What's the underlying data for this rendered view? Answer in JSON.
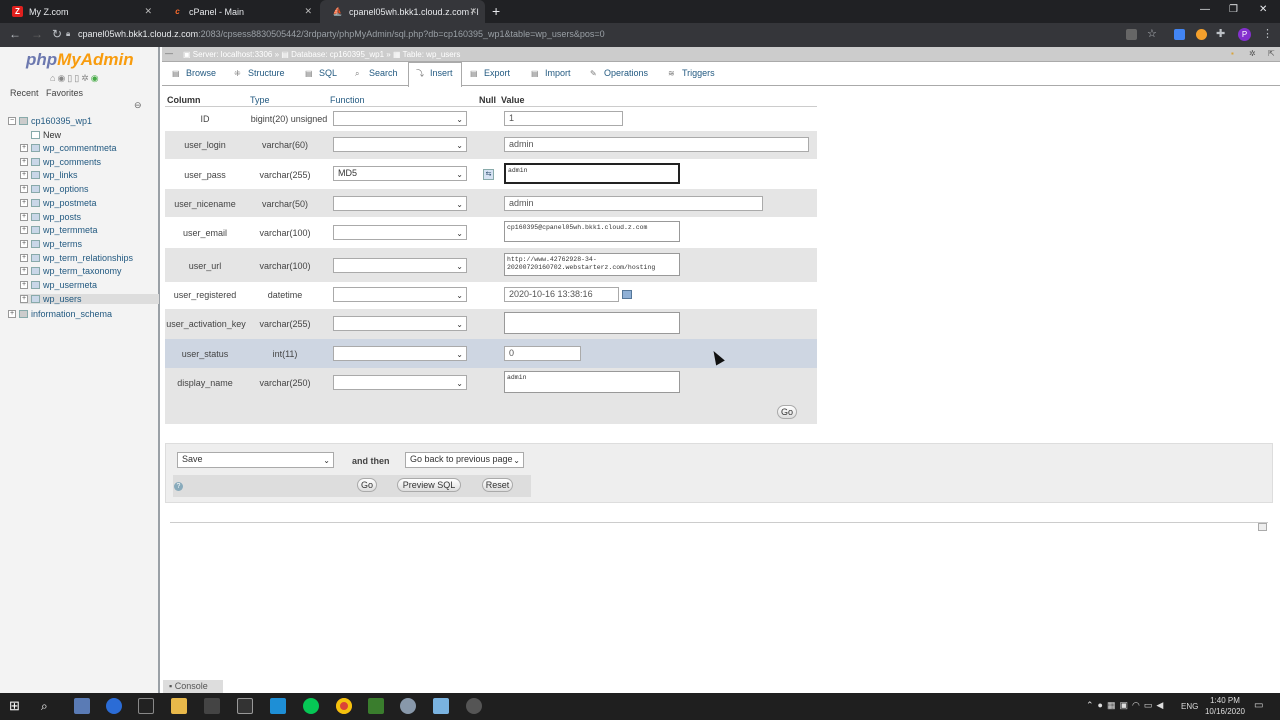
{
  "browser": {
    "tabs": [
      {
        "label": "My Z.com",
        "favicon": "Z"
      },
      {
        "label": "cPanel - Main",
        "favicon": "c"
      },
      {
        "label": "cpanel05wh.bkk1.cloud.z.com / l",
        "favicon": "pma"
      }
    ],
    "url_host": "cpanel05wh.bkk1.cloud.z.com",
    "url_rest": ":2083/cpsess8830505442/3rdparty/phpMyAdmin/sql.php?db=cp160395_wp1&table=wp_users&pos=0",
    "profile_initial": "P"
  },
  "nav": {
    "logo_php": "php",
    "logo_myadmin": "MyAdmin",
    "recent": "Recent",
    "favorites": "Favorites",
    "db": "cp160395_wp1",
    "new": "New",
    "tables": [
      "wp_commentmeta",
      "wp_comments",
      "wp_links",
      "wp_options",
      "wp_postmeta",
      "wp_posts",
      "wp_termmeta",
      "wp_terms",
      "wp_term_relationships",
      "wp_term_taxonomy",
      "wp_usermeta",
      "wp_users"
    ],
    "info_schema": "information_schema"
  },
  "breadcrumb": {
    "server": "Server: localhost:3306",
    "database": "Database: cp160395_wp1",
    "table": "Table: wp_users"
  },
  "tabs": [
    "Browse",
    "Structure",
    "SQL",
    "Search",
    "Insert",
    "Export",
    "Import",
    "Operations",
    "Triggers"
  ],
  "headers": {
    "column": "Column",
    "type": "Type",
    "function": "Function",
    "null": "Null",
    "value": "Value"
  },
  "rows": [
    {
      "name": "ID",
      "type": "bigint(20) unsigned",
      "function": "",
      "value": "1"
    },
    {
      "name": "user_login",
      "type": "varchar(60)",
      "function": "",
      "value": "admin"
    },
    {
      "name": "user_pass",
      "type": "varchar(255)",
      "function": "MD5",
      "value": "admin"
    },
    {
      "name": "user_nicename",
      "type": "varchar(50)",
      "function": "",
      "value": "admin"
    },
    {
      "name": "user_email",
      "type": "varchar(100)",
      "function": "",
      "value": "cp160395@cpanel05wh.bkk1.cloud.z.com"
    },
    {
      "name": "user_url",
      "type": "varchar(100)",
      "function": "",
      "value": "http://www.42762928-34-\n20200720160702.webstarterz.com/hosting"
    },
    {
      "name": "user_registered",
      "type": "datetime",
      "function": "",
      "value": "2020-10-16 13:38:16"
    },
    {
      "name": "user_activation_key",
      "type": "varchar(255)",
      "function": "",
      "value": ""
    },
    {
      "name": "user_status",
      "type": "int(11)",
      "function": "",
      "value": "0"
    },
    {
      "name": "display_name",
      "type": "varchar(250)",
      "function": "",
      "value": "admin"
    }
  ],
  "go": "Go",
  "footer": {
    "save": "Save",
    "and_then": "and then",
    "then_option": "Go back to previous page",
    "go": "Go",
    "preview": "Preview SQL",
    "reset": "Reset"
  },
  "console": "Console",
  "taskbar": {
    "lang": "ENG",
    "time": "1:40 PM",
    "date": "10/16/2020"
  }
}
